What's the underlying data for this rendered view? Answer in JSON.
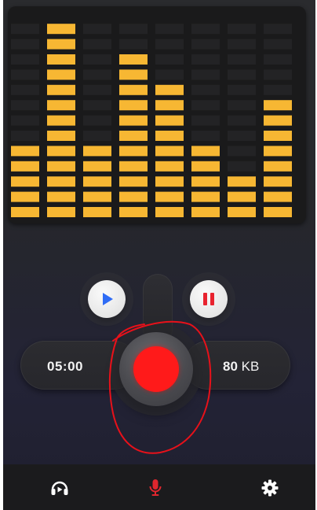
{
  "equalizer": {
    "bar_color": "#f7b733",
    "empty_color": "#232325",
    "total_segments": 13,
    "columns": [
      {
        "lit_segments": 5
      },
      {
        "lit_segments": 13
      },
      {
        "lit_segments": 5
      },
      {
        "lit_segments": 11
      },
      {
        "lit_segments": 9
      },
      {
        "lit_segments": 5
      },
      {
        "lit_segments": 3
      },
      {
        "lit_segments": 8
      }
    ]
  },
  "recorder": {
    "timer": "05:00",
    "size_value": "80",
    "size_unit": "KB",
    "record_color": "#ff1a1a",
    "play_color": "#2f6cf5",
    "pause_color": "#e8232f"
  },
  "nav": {
    "active_color": "#e0262e",
    "items": [
      {
        "icon": "player-icon",
        "active": false
      },
      {
        "icon": "mic-icon",
        "active": true
      },
      {
        "icon": "settings-icon",
        "active": false
      }
    ]
  },
  "annotation": {
    "color": "#e8111a"
  }
}
